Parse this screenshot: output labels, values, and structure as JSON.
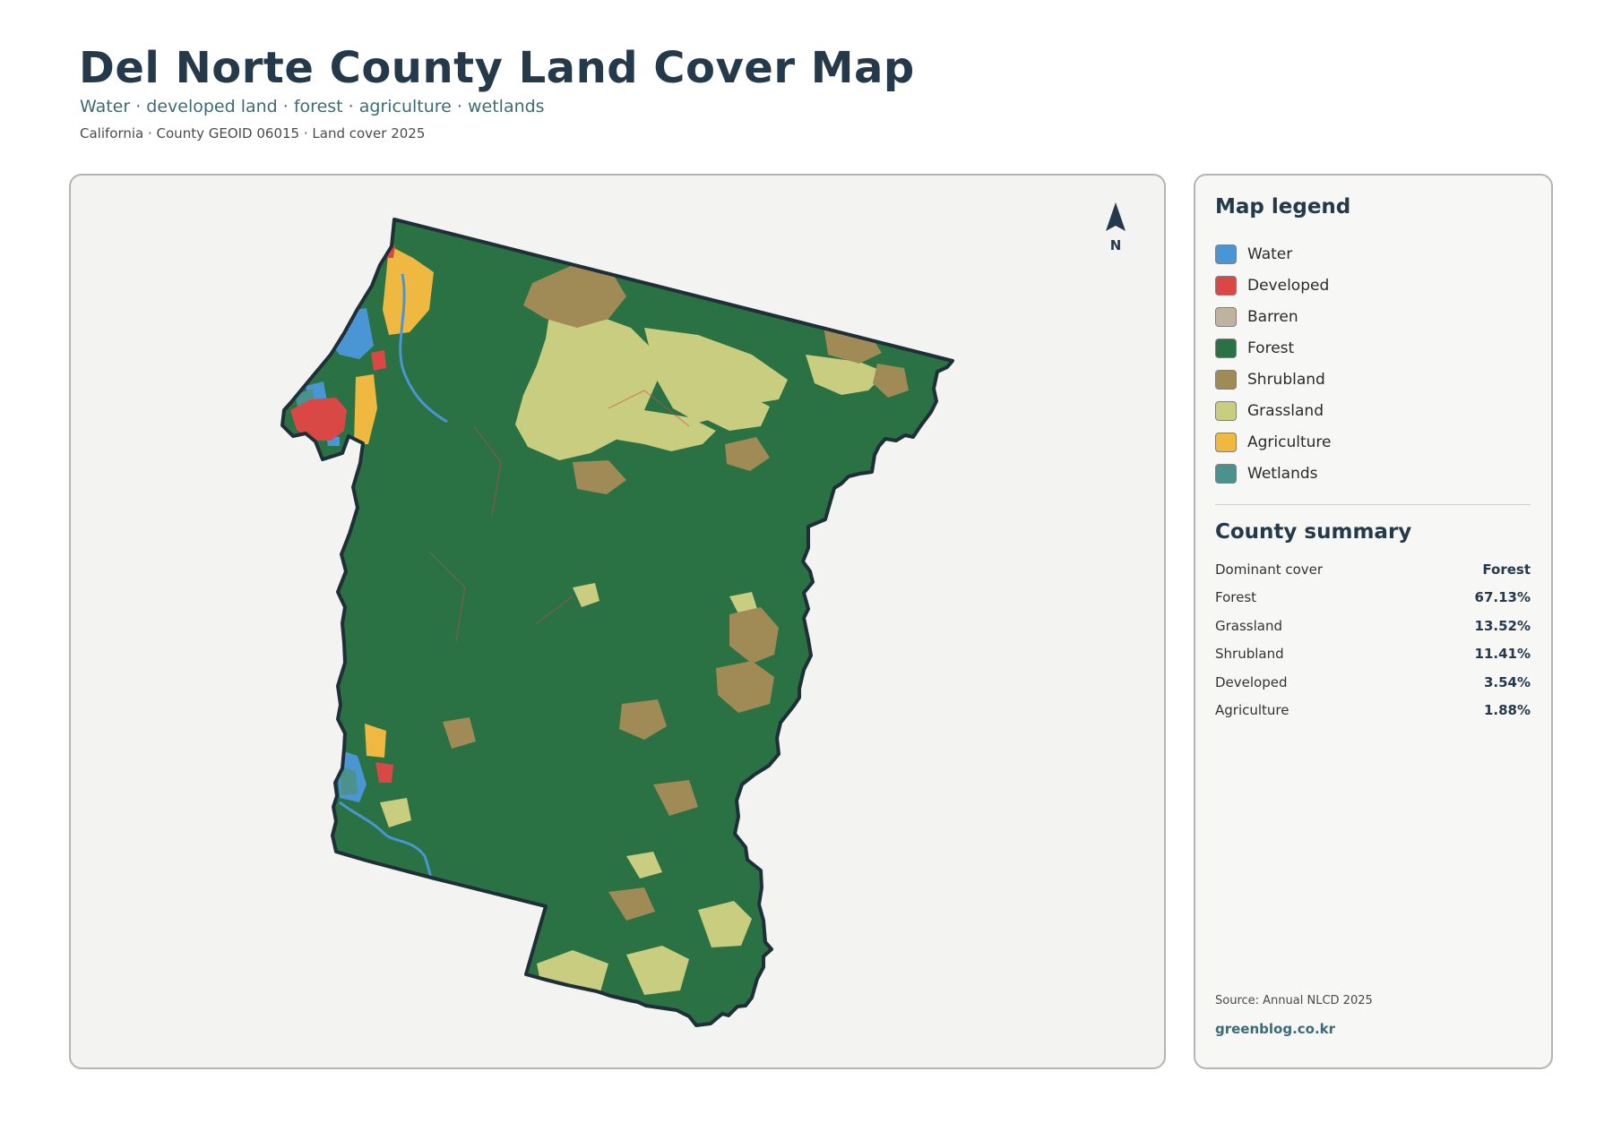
{
  "header": {
    "title": "Del Norte County Land Cover Map",
    "subtitle": "Water · developed land · forest · agriculture · wetlands",
    "meta": "California · County GEOID 06015 · Land cover 2025"
  },
  "map": {
    "north_label": "N",
    "background": "#f3f3f2",
    "outline": "#1f2f38"
  },
  "legend": {
    "title": "Map legend",
    "items": [
      {
        "label": "Water",
        "color": "#4a96d4"
      },
      {
        "label": "Developed",
        "color": "#d94845"
      },
      {
        "label": "Barren",
        "color": "#bfb3a0"
      },
      {
        "label": "Forest",
        "color": "#2a7144"
      },
      {
        "label": "Shrubland",
        "color": "#a08a55"
      },
      {
        "label": "Grassland",
        "color": "#c8cd80"
      },
      {
        "label": "Agriculture",
        "color": "#eeb841"
      },
      {
        "label": "Wetlands",
        "color": "#4b918e"
      }
    ]
  },
  "summary": {
    "title": "County summary",
    "rows": [
      {
        "label": "Dominant cover",
        "value": "Forest"
      },
      {
        "label": "Forest",
        "value": "67.13%"
      },
      {
        "label": "Grassland",
        "value": "13.52%"
      },
      {
        "label": "Shrubland",
        "value": "11.41%"
      },
      {
        "label": "Developed",
        "value": "3.54%"
      },
      {
        "label": "Agriculture",
        "value": "1.88%"
      }
    ]
  },
  "footer": {
    "source": "Source: Annual NLCD 2025",
    "website": "greenblog.co.kr"
  }
}
